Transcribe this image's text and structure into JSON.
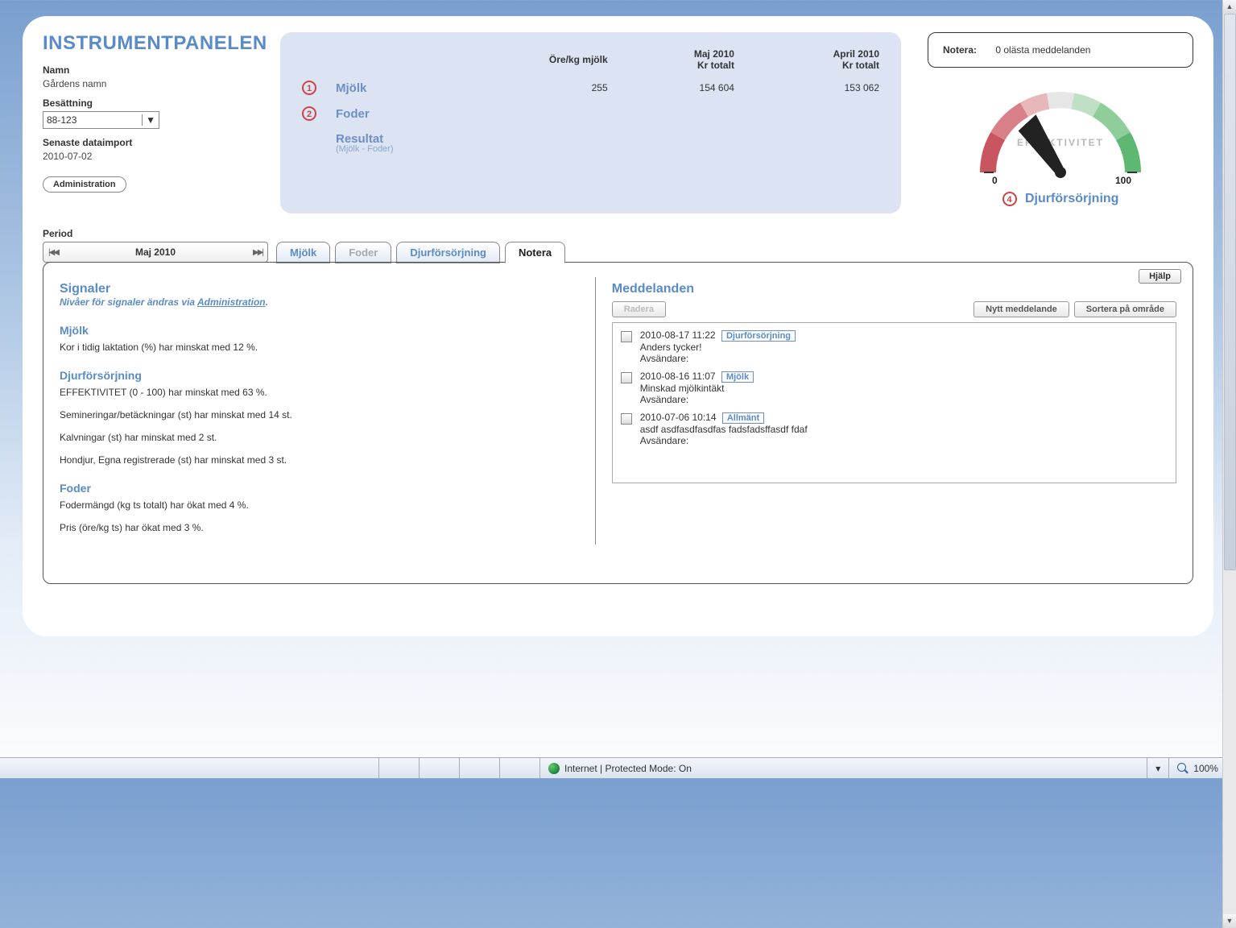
{
  "title": "INSTRUMENTPANELEN",
  "left": {
    "name_label": "Namn",
    "name_value": "Gårdens namn",
    "herd_label": "Besättning",
    "herd_value": "88-123",
    "import_label": "Senaste dataimport",
    "import_value": "2010-07-02",
    "admin_btn": "Administration"
  },
  "summary": {
    "col1": "Öre/kg mjölk",
    "col2_top": "Maj 2010",
    "col2_sub": "Kr totalt",
    "col3_top": "April 2010",
    "col3_sub": "Kr totalt",
    "rows": [
      {
        "num": "1",
        "label": "Mjölk",
        "v1": "255",
        "v2": "154 604",
        "v3": "153 062"
      },
      {
        "num": "2",
        "label": "Foder",
        "v1": "",
        "v2": "",
        "v3": ""
      }
    ],
    "result_label": "Resultat",
    "result_sub": "(Mjölk - Foder)"
  },
  "notebox": {
    "label": "Notera:",
    "text": "0 olästa meddelanden"
  },
  "gauge": {
    "label": "EFFEKTIVITET",
    "min": "0",
    "max": "100",
    "num": "4",
    "title": "Djurförsörjning",
    "value": 37
  },
  "period": {
    "label": "Period",
    "current": "Maj 2010"
  },
  "tabs": {
    "t1": "Mjölk",
    "t2": "Foder",
    "t3": "Djurförsörjning",
    "t4": "Notera"
  },
  "help_btn": "Hjälp",
  "signals": {
    "title": "Signaler",
    "sub_pre": "Nivåer för signaler ändras via ",
    "sub_link": "Administration",
    "cat1": "Mjölk",
    "l1": "Kor i tidig laktation (%) har minskat med 12 %.",
    "cat2": "Djurförsörjning",
    "l2": "EFFEKTIVITET (0 - 100) har minskat med 63 %.",
    "l3": "Semineringar/betäckningar (st) har minskat med 14 st.",
    "l4": "Kalvningar (st) har minskat med 2 st.",
    "l5": "Hondjur, Egna registrerade (st) har minskat med 3 st.",
    "cat3": "Foder",
    "l6": "Fodermängd (kg ts totalt) har ökat med 4 %.",
    "l7": "Pris (öre/kg ts) har ökat med 3 %."
  },
  "messages": {
    "title": "Meddelanden",
    "btn_del": "Radera",
    "btn_new": "Nytt meddelande",
    "btn_sort": "Sortera på område",
    "sender_label": "Avsändare:",
    "items": [
      {
        "ts": "2010-08-17 11:22",
        "tag": "Djurförsörjning",
        "text": "Anders tycker!"
      },
      {
        "ts": "2010-08-16 11:07",
        "tag": "Mjölk",
        "text": "Minskad mjölkintäkt"
      },
      {
        "ts": "2010-07-06 10:14",
        "tag": "Allmänt",
        "text": "asdf asdfasdfasdfas fadsfadsffasdf fdaf"
      }
    ]
  },
  "status": {
    "zone": "Internet | Protected Mode: On",
    "zoom": "100%"
  },
  "chart_data": {
    "type": "gauge",
    "title": "EFFEKTIVITET",
    "subtitle": "Djurförsörjning",
    "min": 0,
    "max": 100,
    "value": 37,
    "colors": [
      "#c85560",
      "#d87f88",
      "#e8b7b9",
      "#e6e6e6",
      "#bfe0c4",
      "#8fcd9a",
      "#5fb871"
    ]
  }
}
